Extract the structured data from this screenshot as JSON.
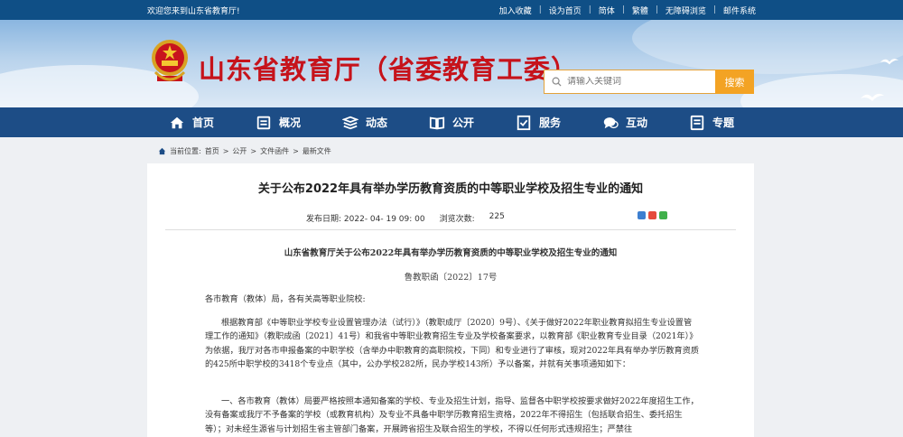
{
  "topbar": {
    "welcome": "欢迎您来到山东省教育厅!",
    "links": [
      "加入收藏",
      "设为首页",
      "简体",
      "繁體",
      "无障碍浏览",
      "邮件系统"
    ]
  },
  "header": {
    "site_title": "山东省教育厅（省委教育工委）",
    "search_placeholder": "请输入关键词",
    "search_button": "搜索"
  },
  "nav": [
    {
      "label": "首页",
      "icon": "home-icon"
    },
    {
      "label": "概况",
      "icon": "overview-icon"
    },
    {
      "label": "动态",
      "icon": "news-icon"
    },
    {
      "label": "公开",
      "icon": "book-icon"
    },
    {
      "label": "服务",
      "icon": "service-icon"
    },
    {
      "label": "互动",
      "icon": "chat-icon"
    },
    {
      "label": "专题",
      "icon": "topic-icon"
    }
  ],
  "breadcrumb": {
    "prefix": "当前位置:",
    "items": [
      "首页",
      "公开",
      "文件函件",
      "最新文件"
    ]
  },
  "article": {
    "title": "关于公布2022年具有举办学历教育资质的中等职业学校及招生专业的通知",
    "date_label": "发布日期:",
    "date_value": "2022- 04- 19 09: 00",
    "views_label": "浏览次数:",
    "views_value": "225",
    "doc_title": "山东省教育厅关于公布2022年具有举办学历教育资质的中等职业学校及招生专业的通知",
    "doc_no": "鲁教职函〔2022〕17号",
    "addressee": "各市教育（教体）局，各有关高等职业院校:",
    "para1": "根据教育部《中等职业学校专业设置管理办法（试行）》（教职成厅〔2020〕9号）、《关于做好2022年职业教育拟招生专业设置管理工作的通知》（教职成函〔2021〕41号）和我省中等职业教育招生专业及学校备案要求，以教育部《职业教育专业目录（2021年）》为依据，我厅对各市申报备案的中职学校（含举办中职教育的高职院校，下同）和专业进行了审核，现对2022年具有举办学历教育资质的425所中职学校的3418个专业点（其中，公办学校282所，民办学校143所）予以备案，并就有关事项通知如下：",
    "para2": "一、各市教育（教体）局要严格按照本通知备案的学校、专业及招生计划，指导、监督各中职学校按要求做好2022年度招生工作，没有备案或我厅不予备案的学校（或教育机构）及专业不具备中职学历教育招生资格，2022年不得招生（包括联合招生、委托招生等）；对未经生源省与计划招生省主管部门备案，开展跨省招生及联合招生的学校，不得以任何形式违规招生；严禁往"
  },
  "colors": {
    "topbar": "#0f4f86",
    "nav": "#1d4d86",
    "title_red": "#c6131b",
    "search_orange": "#f3a324"
  }
}
